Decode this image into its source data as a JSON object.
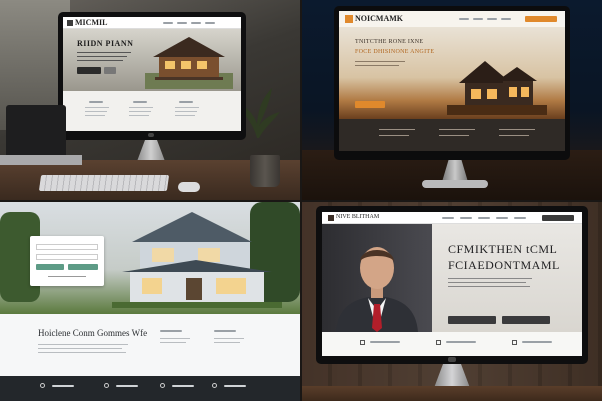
{
  "q1": {
    "logo": "MICMIL",
    "hero_title": "RIIDN PIANN",
    "cta_label": "",
    "sections": [
      "",
      "",
      ""
    ]
  },
  "q2": {
    "logo": "NOICMAMK",
    "hero_line1": "TNITCTHE RONE IXNE",
    "hero_line2": "FOCE DHISINONE ANGITE",
    "cta_label": ""
  },
  "q3": {
    "heading": "Hoiclene Conm Gommes Wfe",
    "login_button": "",
    "login_link": "",
    "footer_items": [
      "",
      "",
      "",
      ""
    ]
  },
  "q4": {
    "logo": "NIVE BLITHAM",
    "heading_line1": "CFMIKTHEN tCML",
    "heading_line2": "FCIAEDONTMAML",
    "primary_button": "",
    "secondary_button": "",
    "features": [
      "",
      "",
      ""
    ]
  },
  "colors": {
    "q1_screen_bg": "#f2f1ee",
    "q1_header": "#ffffff",
    "q2_accent": "#e0892c",
    "q3_teal": "#5d9b86",
    "q3_footer": "#23272b",
    "q4_red_tie": "#b21e2a"
  }
}
